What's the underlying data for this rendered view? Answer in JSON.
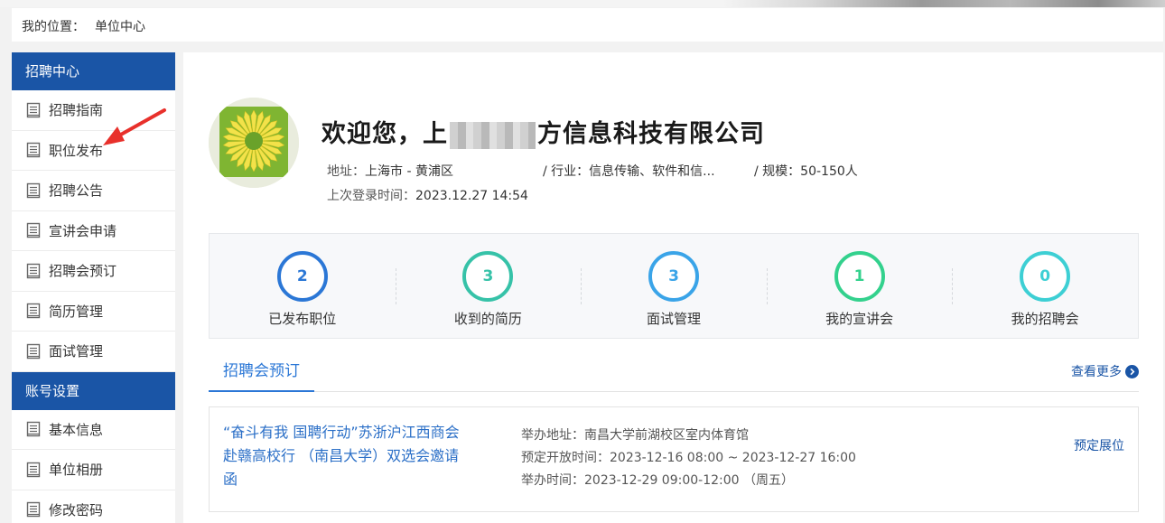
{
  "breadcrumb": {
    "label": "我的位置：",
    "value": "单位中心"
  },
  "sidebar": {
    "recruit_header": "招聘中心",
    "recruit_items": [
      {
        "label": "招聘指南"
      },
      {
        "label": "职位发布"
      },
      {
        "label": "招聘公告"
      },
      {
        "label": "宣讲会申请"
      },
      {
        "label": "招聘会预订"
      },
      {
        "label": "简历管理"
      },
      {
        "label": "面试管理"
      }
    ],
    "account_header": "账号设置",
    "account_items": [
      {
        "label": "基本信息"
      },
      {
        "label": "单位相册"
      },
      {
        "label": "修改密码"
      }
    ]
  },
  "profile": {
    "welcome_prefix": "欢迎您，",
    "company_visible_start": "上",
    "company_visible_end": "方信息科技有限公司",
    "address_label": "地址：",
    "address_value": "上海市 - 黄浦区",
    "industry_label": "/ 行业：",
    "industry_value": "信息传输、软件和信...",
    "scale_label": "/ 规模：",
    "scale_value": "50-150人",
    "login_label": "上次登录时间：",
    "login_value": "2023.12.27 14:54"
  },
  "stats": [
    {
      "value": "2",
      "label": "已发布职位",
      "color": "#2b77d6"
    },
    {
      "value": "3",
      "label": "收到的简历",
      "color": "#36c2a8"
    },
    {
      "value": "3",
      "label": "面试管理",
      "color": "#3aa4e8"
    },
    {
      "value": "1",
      "label": "我的宣讲会",
      "color": "#33d18d"
    },
    {
      "value": "0",
      "label": "我的招聘会",
      "color": "#3dcfd4"
    }
  ],
  "tabs": {
    "active": "招聘会预订",
    "more": "查看更多"
  },
  "fair": {
    "title": "“奋斗有我 国聘行动”苏浙沪江西商会赴赣高校行 （南昌大学）双选会邀请函",
    "venue": "举办地址：南昌大学前湖校区室内体育馆",
    "booking": "预定开放时间：2023-12-16 08:00 ~ 2023-12-27 16:00",
    "time": "举办时间：2023-12-29 09:00-12:00 （周五）",
    "action": "预定展位"
  },
  "colors": {
    "brand": "#1a55a6",
    "accent": "#2b77d6",
    "arrow": "#e8302b"
  }
}
